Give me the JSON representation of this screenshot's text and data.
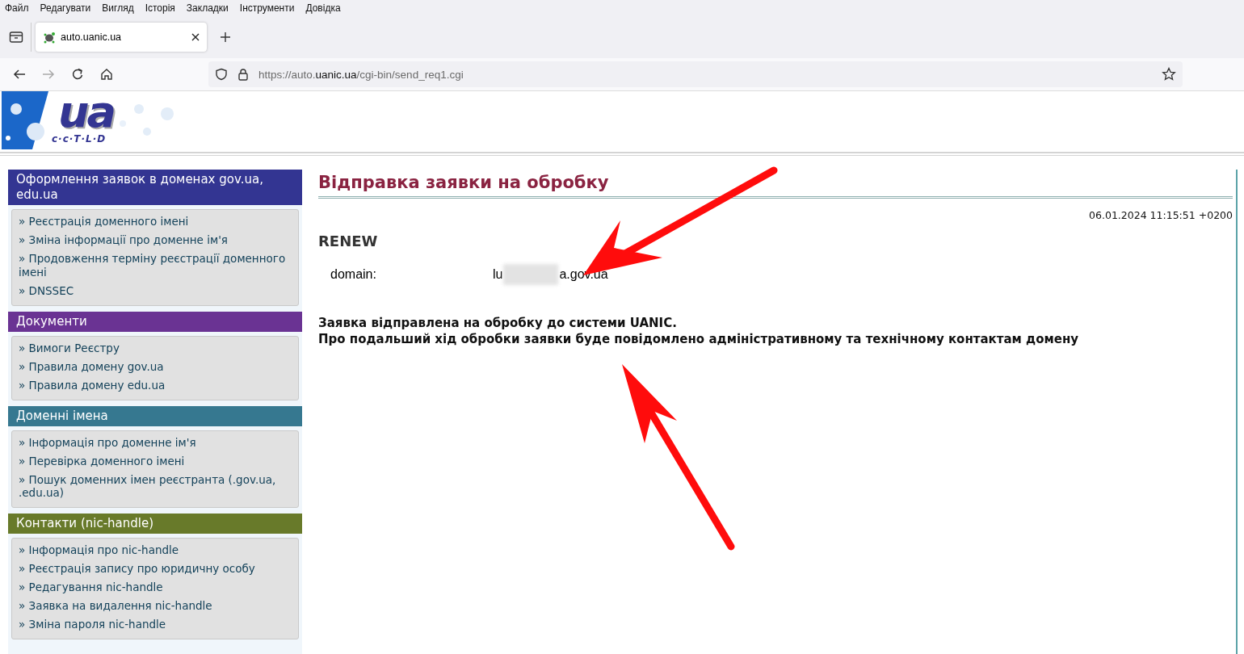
{
  "menu_bar": [
    "Файл",
    "Редагувати",
    "Вигляд",
    "Історія",
    "Закладки",
    "Інструменти",
    "Довідка"
  ],
  "tabs": [
    {
      "label": "auto.uanic.ua",
      "selected": true
    }
  ],
  "address_bar": {
    "url_prefix": "https://auto.",
    "url_host": "uanic.ua",
    "url_path": "/cgi-bin/send_req1.cgi"
  },
  "logo": {
    "mark": "ua",
    "tagline": "c·c·T·L·D"
  },
  "sidebar": [
    {
      "title": "Оформлення заявок в доменах gov.ua, edu.ua",
      "color": "#333592",
      "items": [
        "» Реєстрація доменного імені",
        "» Зміна інформації про доменне ім'я",
        "» Продовження терміну реєстрації доменного імені",
        "» DNSSEC"
      ]
    },
    {
      "title": "Документи",
      "color": "#6a3393",
      "items": [
        "» Вимоги Реєстру",
        "» Правила домену gov.ua",
        "» Правила домену edu.ua"
      ]
    },
    {
      "title": "Доменні імена",
      "color": "#367890",
      "items": [
        "» Інформація про доменне ім'я",
        "» Перевірка доменного імені",
        "» Пошук доменних імен реєстранта (.gov.ua, .edu.ua)"
      ]
    },
    {
      "title": "Контакти (nic-handle)",
      "color": "#687a2a",
      "items": [
        "» Інформація про nic-handle",
        "» Реєстрація запису про юридичну особу",
        "» Редагування nic-handle",
        "» Заявка на видалення nic-handle",
        "» Зміна пароля nic-handle"
      ]
    }
  ],
  "main": {
    "title": "Відправка заявки на обробку",
    "timestamp": "06.01.2024 11:15:51 +0200",
    "action": "RENEW",
    "fields": [
      {
        "label": "domain:",
        "value_start": "lu",
        "redacted": true,
        "value_end": "a.gov.ua"
      }
    ],
    "messages": [
      "Заявка відправлена на обробку до системи UANIC.",
      "Про подальший хід обробки заявки буде повідомлено адміністративному та технічному контактам домену"
    ]
  }
}
